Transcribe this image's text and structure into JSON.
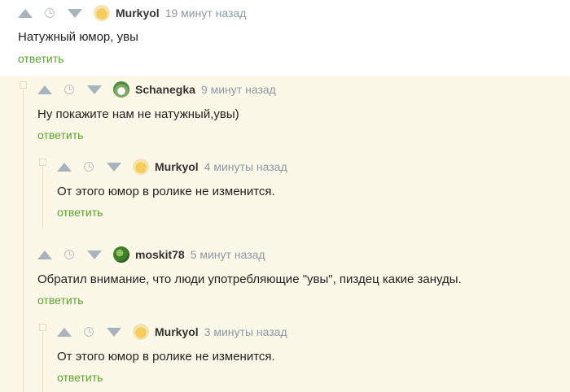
{
  "comments": [
    {
      "author": "Murkyol",
      "time": "19 минут назад",
      "text": "Натужный юмор, увы",
      "reply": "ответить"
    },
    {
      "author": "Schanegka",
      "time": "9 минут назад",
      "text": "Ну покажите нам не натужный,увы)",
      "reply": "ответить"
    },
    {
      "author": "Murkyol",
      "time": "4 минуты назад",
      "text": "От этого юмор в ролике не изменится.",
      "reply": "ответить"
    },
    {
      "author": "moskit78",
      "time": "5 минут назад",
      "text": "Обратил внимание, что люди употребляющие \"увы\", пиздец какие зануды.",
      "reply": "ответить"
    },
    {
      "author": "Murkyol",
      "time": "3 минуты назад",
      "text": "От этого юмор в ролике не изменится.",
      "reply": "ответить"
    }
  ],
  "icons": {
    "upvote": "triangle-up-icon",
    "downvote": "triangle-down-icon",
    "clock": "clock-icon"
  },
  "colors": {
    "reply_link": "#58a32d",
    "thread_background": "#fcf8e8",
    "vote_arrow": "#a7b4bd",
    "timestamp": "#8a9aa4"
  }
}
